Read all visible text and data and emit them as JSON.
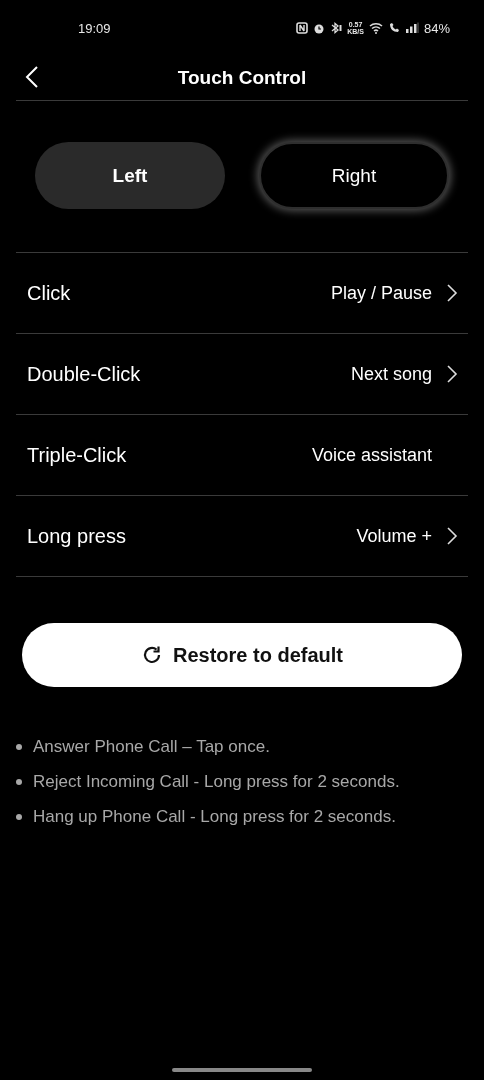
{
  "status_bar": {
    "time": "19:09",
    "speed_value": "0.57",
    "speed_unit": "KB/S",
    "battery": "84%"
  },
  "header": {
    "title": "Touch Control"
  },
  "tabs": [
    {
      "label": "Left",
      "selected": true
    },
    {
      "label": "Right",
      "selected": false
    }
  ],
  "rows": [
    {
      "label": "Click",
      "value": "Play / Pause",
      "has_arrow": true
    },
    {
      "label": "Double-Click",
      "value": "Next song",
      "has_arrow": true
    },
    {
      "label": "Triple-Click",
      "value": "Voice assistant",
      "has_arrow": false
    },
    {
      "label": "Long press",
      "value": "Volume +",
      "has_arrow": true
    }
  ],
  "restore_button": {
    "label": "Restore to default"
  },
  "notes": [
    "Answer Phone Call – Tap once.",
    "Reject Incoming Call - Long press for 2 seconds.",
    "Hang up Phone Call - Long press for 2 seconds."
  ]
}
